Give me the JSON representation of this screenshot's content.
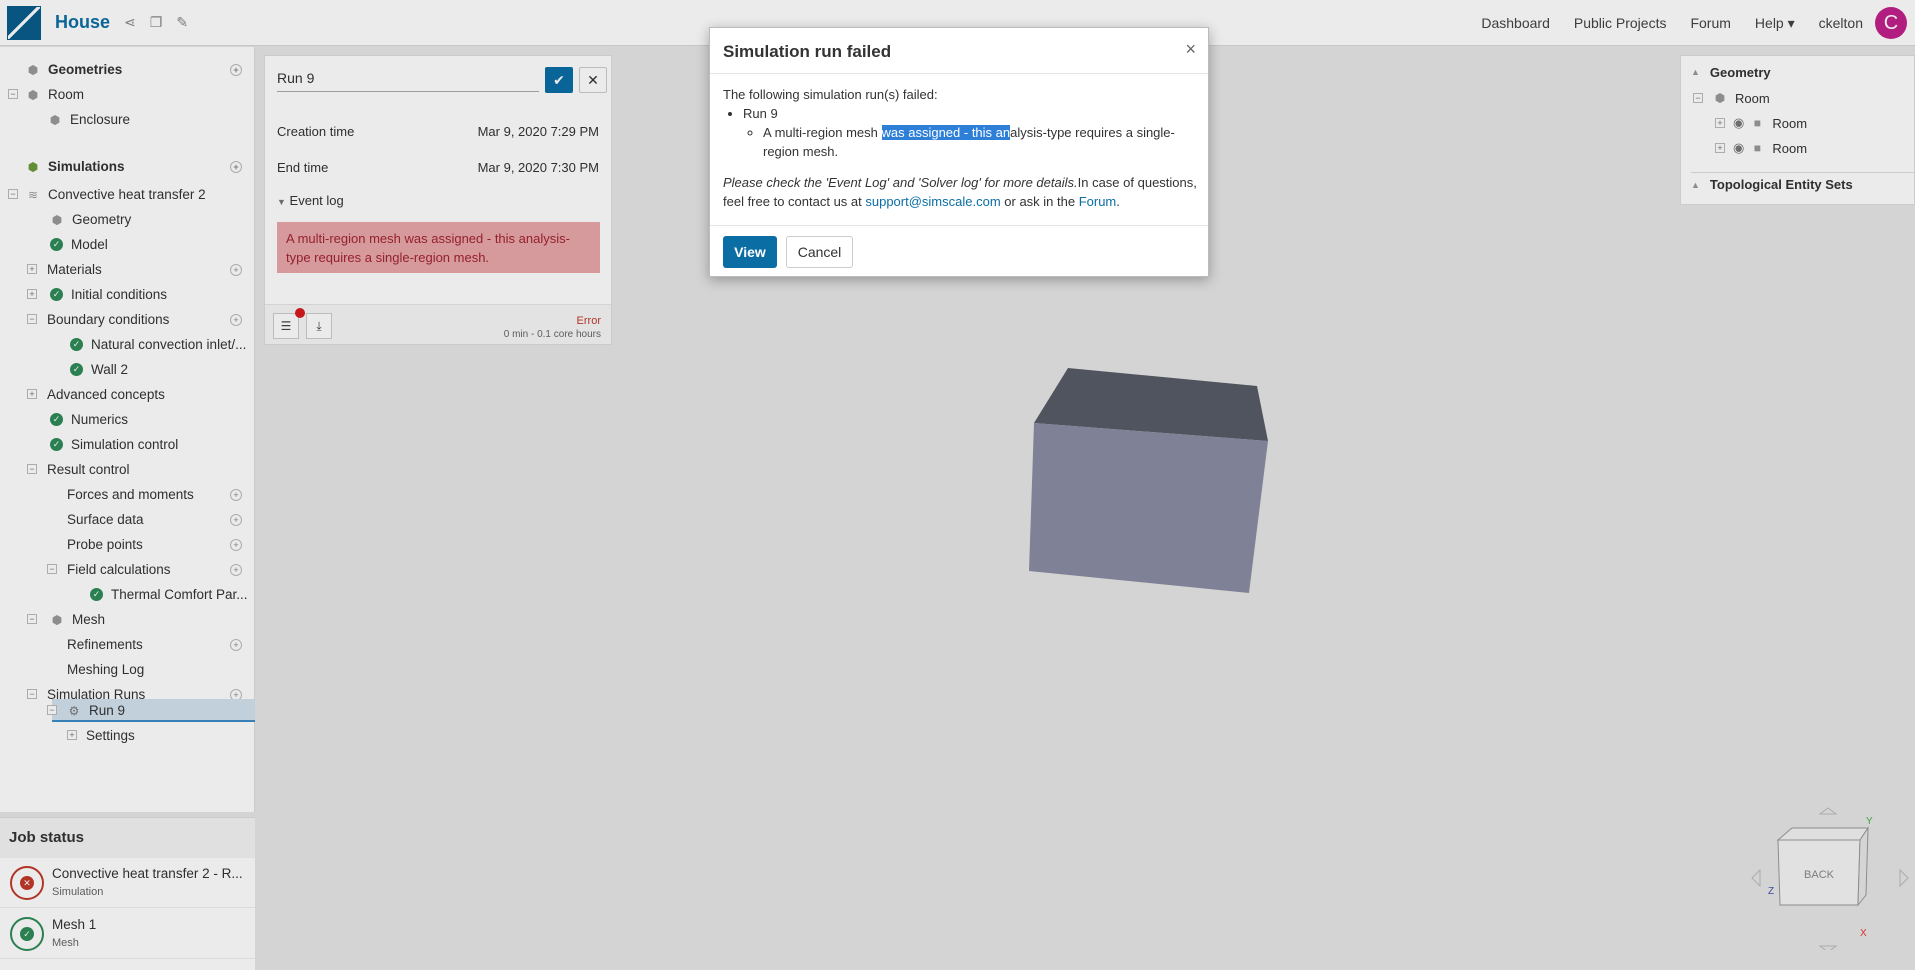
{
  "header": {
    "project_title": "House",
    "nav": [
      "Dashboard",
      "Public Projects",
      "Forum",
      "Help"
    ],
    "help_caret": "▾",
    "username": "ckelton",
    "avatar_initial": "C"
  },
  "sidebar": {
    "geometries_label": "Geometries",
    "room_label": "Room",
    "enclosure_label": "Enclosure",
    "simulations_label": "Simulations",
    "sim_name": "Convective heat transfer 2",
    "geometry": "Geometry",
    "model": "Model",
    "materials": "Materials",
    "initial_conditions": "Initial conditions",
    "boundary_conditions": "Boundary conditions",
    "bc1": "Natural convection inlet/...",
    "bc2": "Wall 2",
    "advanced": "Advanced concepts",
    "numerics": "Numerics",
    "sim_control": "Simulation control",
    "result_control": "Result control",
    "forces": "Forces and moments",
    "surface": "Surface data",
    "probe": "Probe points",
    "field_calc": "Field calculations",
    "thermal": "Thermal Comfort Par...",
    "mesh": "Mesh",
    "refinements": "Refinements",
    "meshing_log": "Meshing Log",
    "sim_runs": "Simulation Runs",
    "run9": "Run 9",
    "settings": "Settings"
  },
  "job_status": {
    "title": "Job status",
    "jobs": [
      {
        "title": "Convective heat transfer 2 - R...",
        "subtitle": "Simulation",
        "status": "error"
      },
      {
        "title": "Mesh 1",
        "subtitle": "Mesh",
        "status": "success"
      }
    ]
  },
  "run_panel": {
    "name": "Run 9",
    "creation_label": "Creation time",
    "creation_value": "Mar 9, 2020 7:29 PM",
    "end_label": "End time",
    "end_value": "Mar 9, 2020 7:30 PM",
    "event_log_label": "Event log",
    "error_message": "A multi-region mesh was assigned - this analysis-type requires a single-region mesh.",
    "status": "Error",
    "hours": "0 min - 0.1 core hours"
  },
  "right_panel": {
    "geometry_label": "Geometry",
    "room_root": "Room",
    "room_a": "Room",
    "room_b": "Room",
    "topo_label": "Topological Entity Sets"
  },
  "modal": {
    "title": "Simulation run failed",
    "close": "×",
    "intro": "The following simulation run(s) failed:",
    "run": "Run 9",
    "msg_pre": "A multi-region mesh ",
    "msg_hl": "was assigned - this an",
    "msg_post": "alysis-type requires a single-region mesh.",
    "note_italic": "Please check the 'Event Log' and 'Solver log' for more details.",
    "note_rest": "In case of questions, feel free to contact us at ",
    "email": "support@simscale.com",
    "note_mid": " or ask in the ",
    "forum": "Forum",
    "note_end": ".",
    "view_button": "View",
    "cancel_button": "Cancel"
  },
  "viewcube": {
    "face_label": "BACK",
    "axis_x": "X",
    "axis_y": "Y",
    "axis_z": "Z"
  },
  "colors": {
    "accent": "#0a6ea5",
    "error": "#d71920",
    "success": "#2e8b57",
    "avatar": "#c1218a"
  }
}
